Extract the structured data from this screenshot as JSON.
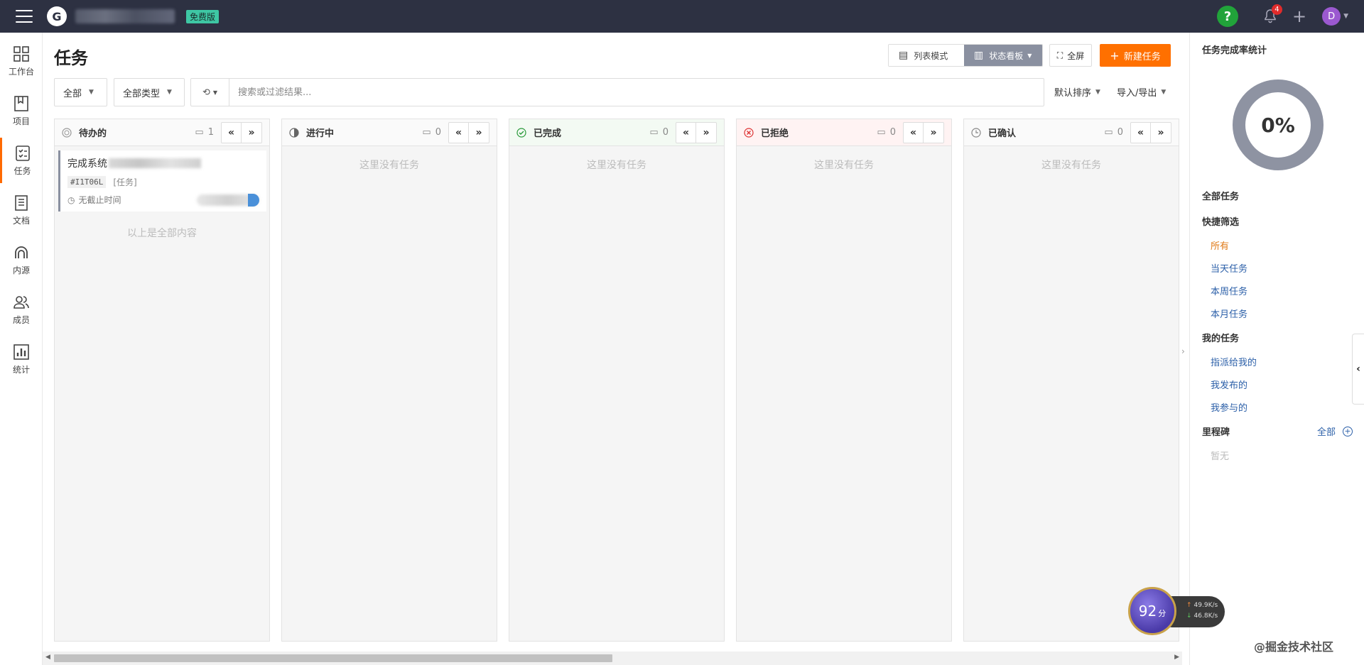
{
  "header": {
    "plan_badge": "免费版",
    "notification_count": "4",
    "avatar_initial": "D",
    "help_glyph": "?"
  },
  "nav": {
    "items": [
      {
        "label": "工作台",
        "icon": "dashboard-icon"
      },
      {
        "label": "项目",
        "icon": "project-icon"
      },
      {
        "label": "任务",
        "icon": "task-icon",
        "active": true
      },
      {
        "label": "文档",
        "icon": "document-icon"
      },
      {
        "label": "内源",
        "icon": "innersource-icon"
      },
      {
        "label": "成员",
        "icon": "members-icon"
      },
      {
        "label": "统计",
        "icon": "statistics-icon"
      }
    ]
  },
  "page": {
    "title": "任务",
    "view_list_label": "列表模式",
    "view_board_label": "状态看板",
    "fullscreen_label": "全屏",
    "new_task_label": "新建任务"
  },
  "filters": {
    "scope": "全部",
    "type": "全部类型",
    "search_placeholder": "搜索或过滤结果...",
    "sort": "默认排序",
    "import_export": "导入/导出"
  },
  "columns": [
    {
      "title": "待办的",
      "count": "1",
      "status": "todo"
    },
    {
      "title": "进行中",
      "count": "0",
      "status": "in-progress",
      "empty": "这里没有任务"
    },
    {
      "title": "已完成",
      "count": "0",
      "status": "done",
      "empty": "这里没有任务"
    },
    {
      "title": "已拒绝",
      "count": "0",
      "status": "rejected",
      "empty": "这里没有任务"
    },
    {
      "title": "已确认",
      "count": "0",
      "status": "confirmed",
      "empty": "这里没有任务"
    }
  ],
  "task": {
    "title": "完成系统",
    "id": "#I1T06L",
    "type": "[任务]",
    "due": "无截止时间",
    "all_loaded": "以上是全部内容"
  },
  "right_panel": {
    "title": "任务完成率统计",
    "completion_percent": "0%",
    "all_tasks": "全部任务",
    "quick_filter": "快捷筛选",
    "quick_items": [
      "所有",
      "当天任务",
      "本周任务",
      "本月任务"
    ],
    "my_tasks": "我的任务",
    "my_items": [
      "指派给我的",
      "我发布的",
      "我参与的"
    ],
    "milestone": "里程碑",
    "milestone_all": "全部",
    "milestone_empty": "暂无"
  },
  "speed_widget": {
    "score": "92",
    "score_unit": "分",
    "upload": "49.9K/s",
    "download": "46.8K/s"
  },
  "watermark": "@掘金技术社区",
  "colors": {
    "topbar": "#2d3142",
    "accent": "#ff7000",
    "badge": "#3ec7a4",
    "link": "#2b5fa8"
  }
}
